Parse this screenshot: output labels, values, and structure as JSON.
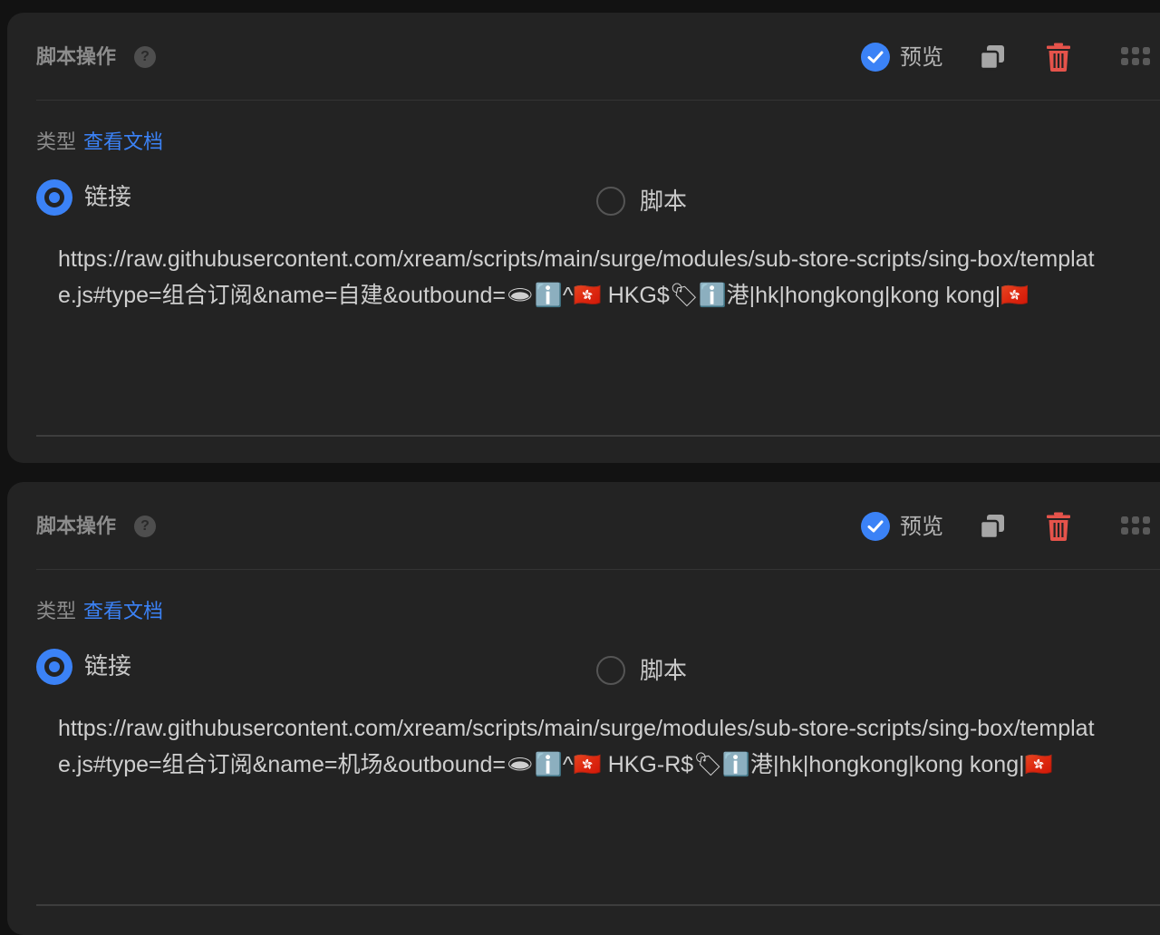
{
  "colors": {
    "page_bg": "#121212",
    "card_bg": "#232323",
    "accent": "#3b82f6",
    "danger": "#e5534b",
    "muted_text": "#8c8c8c",
    "text": "#cfcfcf"
  },
  "cards": [
    {
      "title": "脚本操作",
      "help_icon": "question-circle-icon",
      "preview_label": "预览",
      "preview_checked": true,
      "type_label": "类型",
      "docs_link": "查看文档",
      "radio_options": [
        {
          "label": "链接",
          "selected": true
        },
        {
          "label": "脚本",
          "selected": false
        }
      ],
      "value_text": "https://raw.githubusercontent.com/xream/scripts/main/surge/modules/sub-store-scripts/sing-box/template.js#type=组合订阅&name=自建&outbound=🕳ℹ️^🇭🇰 HKG$🏷ℹ️港|hk|hongkong|kong kong|🇭🇰"
    },
    {
      "title": "脚本操作",
      "help_icon": "question-circle-icon",
      "preview_label": "预览",
      "preview_checked": true,
      "type_label": "类型",
      "docs_link": "查看文档",
      "radio_options": [
        {
          "label": "链接",
          "selected": true
        },
        {
          "label": "脚本",
          "selected": false
        }
      ],
      "value_text": "https://raw.githubusercontent.com/xream/scripts/main/surge/modules/sub-store-scripts/sing-box/template.js#type=组合订阅&name=机场&outbound=🕳ℹ️^🇭🇰 HKG-R$🏷ℹ️港|hk|hongkong|kong kong|🇭🇰"
    }
  ]
}
